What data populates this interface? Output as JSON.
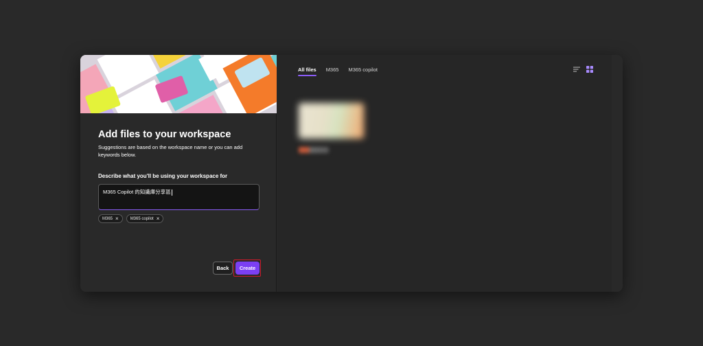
{
  "dialog": {
    "title": "Add files to your workspace",
    "subtitle": "Suggestions are based on the workspace name or you can add keywords below.",
    "field_label": "Describe what you'll be using your workspace for",
    "description_value": "M365 Copilot 的知識庫分享區",
    "tags": [
      {
        "label": "M365",
        "remove_icon": "close-icon"
      },
      {
        "label": "M365 copilot",
        "remove_icon": "close-icon"
      }
    ],
    "buttons": {
      "back": "Back",
      "create": "Create"
    }
  },
  "files_panel": {
    "tabs": [
      {
        "label": "All files",
        "active": true
      },
      {
        "label": "M365",
        "active": false
      },
      {
        "label": "M365 copilot",
        "active": false
      }
    ],
    "view_modes": [
      {
        "icon": "list-view-icon",
        "active": false
      },
      {
        "icon": "grid-view-icon",
        "active": true
      }
    ]
  },
  "colors": {
    "accent": "#7b3ff2",
    "tab_underline": "#8a5cf6",
    "highlight_outline": "#d11a2a",
    "background": "#292929"
  }
}
